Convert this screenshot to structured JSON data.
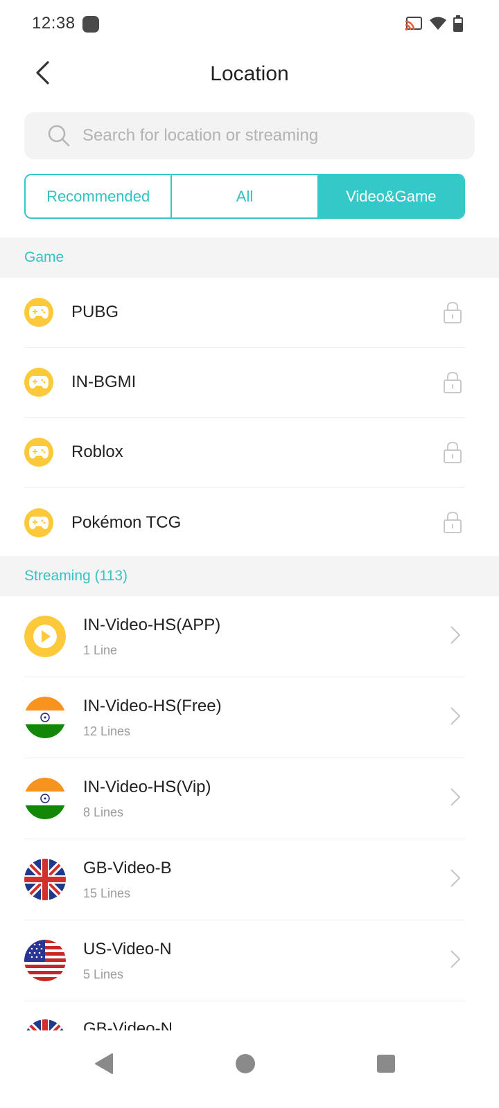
{
  "status_bar": {
    "time": "12:38"
  },
  "header": {
    "title": "Location"
  },
  "search": {
    "placeholder": "Search for location or streaming"
  },
  "tabs": [
    {
      "label": "Recommended",
      "active": false
    },
    {
      "label": "All",
      "active": false
    },
    {
      "label": "Video&Game",
      "active": true
    }
  ],
  "game_section": {
    "title": "Game",
    "items": [
      {
        "name": "PUBG",
        "icon": "gamepad-icon",
        "locked": true
      },
      {
        "name": "IN-BGMI",
        "icon": "gamepad-icon",
        "locked": true
      },
      {
        "name": "Roblox",
        "icon": "gamepad-icon",
        "locked": true
      },
      {
        "name": "Pokémon TCG",
        "icon": "gamepad-icon",
        "locked": true
      }
    ]
  },
  "streaming_section": {
    "title": "Streaming (113)",
    "items": [
      {
        "name": "IN-Video-HS(APP)",
        "lines": "1 Line",
        "icon": "play-icon"
      },
      {
        "name": "IN-Video-HS(Free)",
        "lines": "12 Lines",
        "icon": "india-flag-icon"
      },
      {
        "name": "IN-Video-HS(Vip)",
        "lines": "8 Lines",
        "icon": "india-flag-icon"
      },
      {
        "name": "GB-Video-B",
        "lines": "15 Lines",
        "icon": "uk-flag-icon"
      },
      {
        "name": "US-Video-N",
        "lines": "5 Lines",
        "icon": "us-flag-icon"
      },
      {
        "name": "GB-Video-N",
        "lines": "",
        "icon": "uk-flag-icon"
      }
    ]
  },
  "colors": {
    "accent": "#35c8c8",
    "game_icon": "#fbc93a",
    "section_bg": "#f4f4f4"
  }
}
